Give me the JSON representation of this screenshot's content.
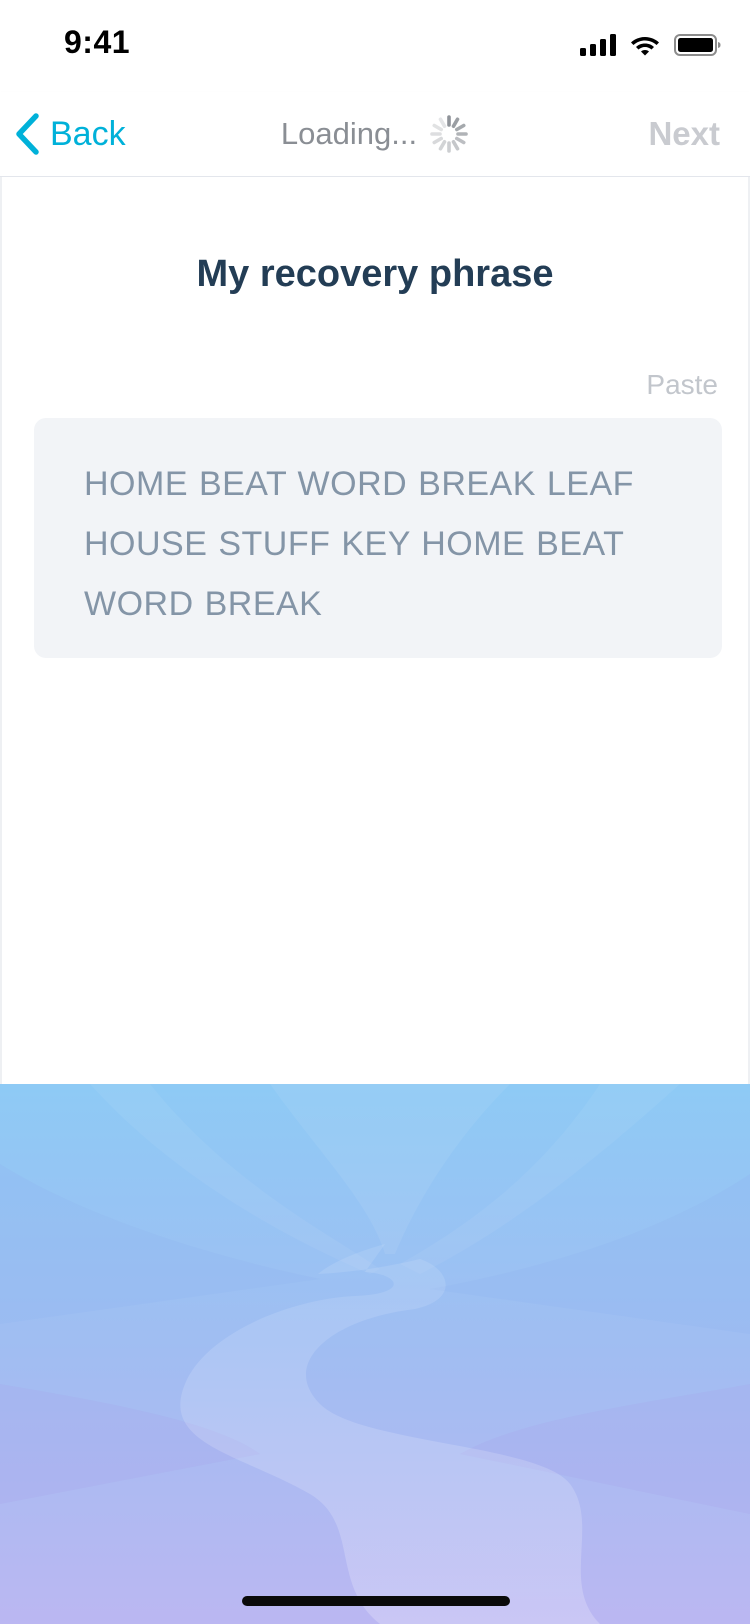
{
  "status_bar": {
    "time": "9:41"
  },
  "nav": {
    "back_label": "Back",
    "title": "Loading...",
    "next_label": "Next"
  },
  "main": {
    "title": "My recovery phrase",
    "paste_label": "Paste",
    "phrase": "HOME BEAT WORD BREAK LEAF HOUSE STUFF KEY HOME BEAT WORD BREAK"
  },
  "icons": {
    "back": "chevron-left-icon",
    "loading": "spinner-icon",
    "signal": "cellular-signal-icon",
    "wifi": "wifi-icon",
    "battery": "battery-icon"
  },
  "colors": {
    "accent": "#00b1d9",
    "title": "#233d55",
    "disabled": "#c9cbd0",
    "phrase_text": "#8495a7",
    "phrase_box": "#f2f4f7",
    "illustration_top": "#8ecaf5",
    "illustration_bottom": "#bbb7f2"
  }
}
